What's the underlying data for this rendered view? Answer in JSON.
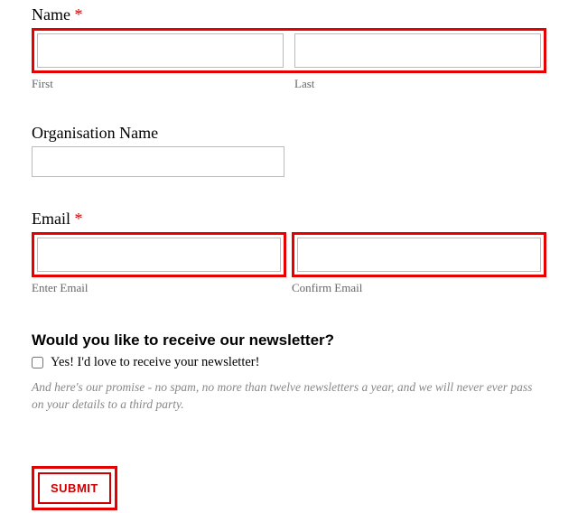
{
  "form": {
    "name": {
      "label": "Name",
      "required_marker": "*",
      "first_sublabel": "First",
      "last_sublabel": "Last"
    },
    "organisation": {
      "label": "Organisation Name"
    },
    "email": {
      "label": "Email",
      "required_marker": "*",
      "enter_sublabel": "Enter Email",
      "confirm_sublabel": "Confirm Email"
    },
    "newsletter": {
      "question": "Would you like to receive our newsletter?",
      "checkbox_label": "Yes! I'd love to receive your newsletter!",
      "promise": "And here's our promise - no spam, no more than twelve newsletters a year, and we will never ever pass on your details to a third party."
    },
    "submit_label": "SUBMIT"
  }
}
